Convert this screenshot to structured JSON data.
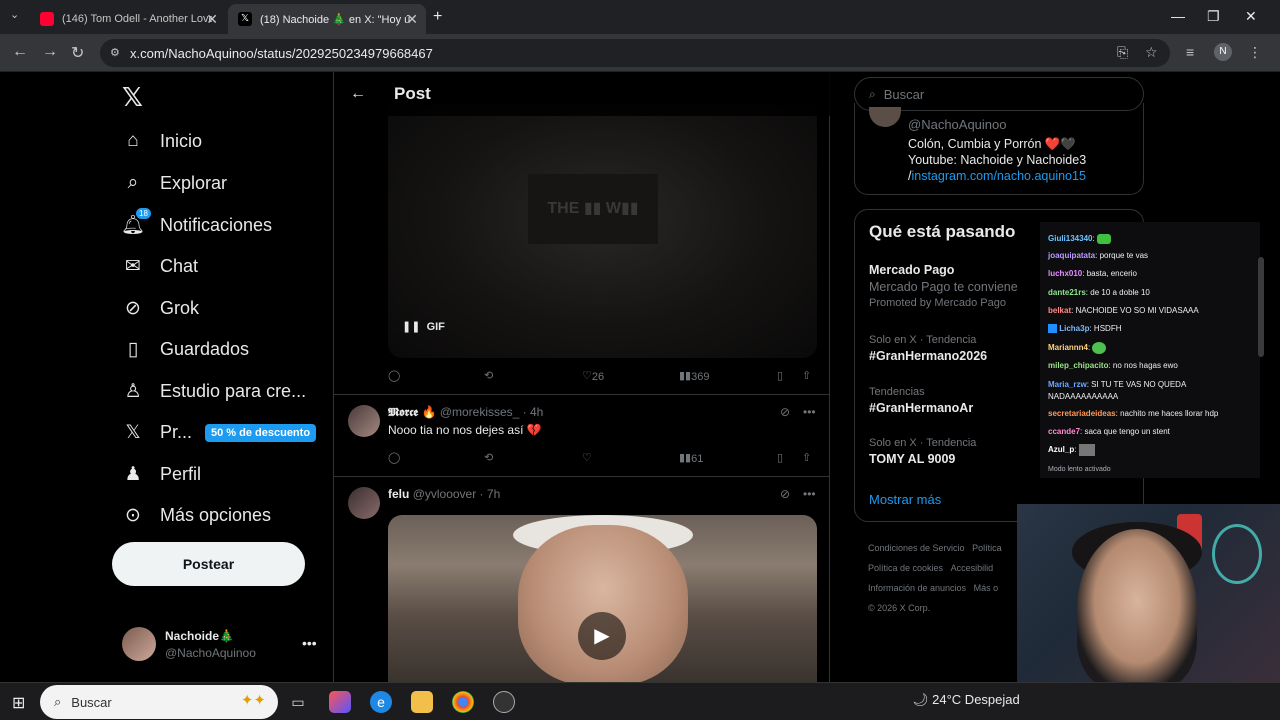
{
  "browser": {
    "tabs": [
      {
        "title": "(146) Tom Odell - Another Love",
        "active": false
      },
      {
        "title": "(18) Nachoide 🎄 en X: \"Hoy últ",
        "active": true
      }
    ],
    "new_tab": "+",
    "url": "x.com/NachoAquinoo/status/2029250234979668467",
    "profile_initial": "N"
  },
  "sidebar": {
    "logo": "𝕏",
    "items": [
      {
        "label": "Inicio",
        "icon": "home-icon"
      },
      {
        "label": "Explorar",
        "icon": "search-icon"
      },
      {
        "label": "Notificaciones",
        "icon": "bell-icon",
        "badge": "18"
      },
      {
        "label": "Chat",
        "icon": "mail-icon"
      },
      {
        "label": "Grok",
        "icon": "grok-icon"
      },
      {
        "label": "Guardados",
        "icon": "bookmark-icon"
      },
      {
        "label": "Estudio para cre...",
        "icon": "studio-icon"
      },
      {
        "label": "Pr...",
        "icon": "x-premium-icon"
      },
      {
        "label": "Perfil",
        "icon": "person-icon"
      },
      {
        "label": "Más opciones",
        "icon": "more-circle-icon"
      }
    ],
    "discount": "50 % de descuento",
    "post_button": "Postear",
    "account": {
      "name": "Nachoide🎄",
      "handle": "@NachoAquinoo"
    }
  },
  "post": {
    "header": "Post",
    "gif_label": "GIF",
    "main_actions": {
      "likes": "26",
      "views": "369"
    },
    "replies": [
      {
        "name": "𝕸𝖔𝖗𝖈𝖊 🔥",
        "handle": "@morekisses_ · 4h",
        "text": "Nooo tia no nos dejes así 💔",
        "views": "61"
      },
      {
        "name": "felu",
        "handle": "@yvlooover · 7h",
        "text": ""
      }
    ]
  },
  "right": {
    "search_placeholder": "Buscar",
    "profile": {
      "handle": "@NachoAquinoo",
      "bio1": "Colón, Cumbia y Porrón ❤️🖤",
      "bio2": "Youtube: Nachoide y Nachoide3",
      "bio3_prefix": "/",
      "bio3_link": "instagram.com/nacho.aquino15"
    },
    "trends_title": "Qué está pasando",
    "trends": [
      {
        "context": "",
        "name": "Mercado Pago",
        "sub": "Mercado Pago te conviene",
        "promo": "Promoted by Mercado Pago"
      },
      {
        "context": "Solo en X · Tendencia",
        "name": "#GranHermano2026"
      },
      {
        "context": "Tendencias",
        "name": "#GranHermanoAr"
      },
      {
        "context": "Solo en X · Tendencia",
        "name": "TOMY AL 9009"
      }
    ],
    "show_more": "Mostrar más",
    "footer": [
      "Condiciones de Servicio",
      "Política",
      "Política de cookies",
      "Accesibilid",
      "Información de anuncios",
      "Más o",
      "© 2026 X Corp."
    ]
  },
  "chat": [
    {
      "user": "Giuli134340",
      "msg": "",
      "color": "#6cc4ff"
    },
    {
      "user": "joaquipatata",
      "msg": "porque te vas",
      "color": "#b89cff"
    },
    {
      "user": "luchx010",
      "msg": "basta, encerio",
      "color": "#e78dff"
    },
    {
      "user": "dante21rs",
      "msg": "de 10 a doble 10",
      "color": "#8fe68f"
    },
    {
      "user": "belkat",
      "msg": "NACHOIDE VO SO MI VIDASAAA",
      "color": "#ff8a8a"
    },
    {
      "user": "Licha3p",
      "msg": "HSDFH",
      "color": "#7ab8ff"
    },
    {
      "user": "Mariannn4",
      "msg": "",
      "color": "#ffd27a"
    },
    {
      "user": "milep_chipacito",
      "msg": "no nos hagas ewo",
      "color": "#9fe08a"
    },
    {
      "user": "Maria_rzw",
      "msg": "SI TU TE VAS NO QUEDA NADAAAAAAAAAA",
      "color": "#6fa8ff"
    },
    {
      "user": "secretariadeideas",
      "msg": "nachito me haces llorar hdp",
      "color": "#ff9a5a"
    },
    {
      "user": "ccande7",
      "msg": "saca que tengo un stent",
      "color": "#ff8ad2"
    },
    {
      "user": "Azul_p",
      "msg": "",
      "color": "#ffffff"
    },
    {
      "user": "",
      "msg": "Modo lento activado",
      "color": "#adadb8"
    }
  ],
  "taskbar": {
    "search_placeholder": "Buscar",
    "weather": "24°C  Despejad"
  }
}
